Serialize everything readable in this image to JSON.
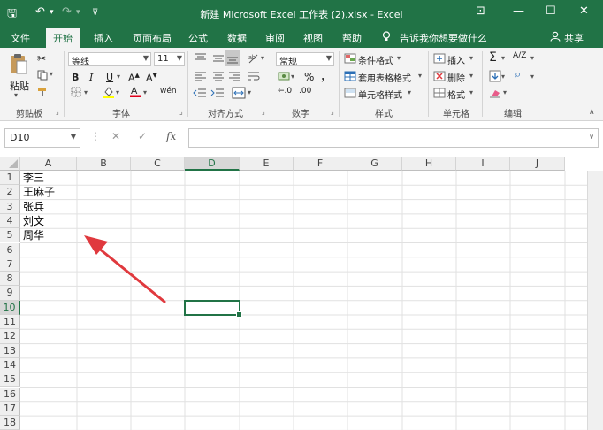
{
  "window": {
    "title": "新建 Microsoft Excel 工作表 (2).xlsx  -  Excel",
    "quick_access": {
      "save_glyph": "🖫",
      "undo_glyph": "↶",
      "undo_arrow": "▾",
      "redo_glyph": "↷",
      "redo_arrow": "▾",
      "customize_glyph": "⊽"
    },
    "controls": {
      "ribbon_opts_glyph": "⊡",
      "minimize_glyph": "—",
      "maximize_glyph": "☐",
      "close_glyph": "✕"
    }
  },
  "tabs": [
    {
      "label": "文件"
    },
    {
      "label": "开始"
    },
    {
      "label": "插入"
    },
    {
      "label": "页面布局"
    },
    {
      "label": "公式"
    },
    {
      "label": "数据"
    },
    {
      "label": "审阅"
    },
    {
      "label": "视图"
    },
    {
      "label": "帮助"
    }
  ],
  "tell_me": {
    "icon": "lightbulb-icon",
    "text": "告诉我你想要做什么"
  },
  "share": {
    "label": "共享",
    "icon": "person-icon"
  },
  "ribbon": {
    "clipboard": {
      "label": "剪贴板",
      "paste": "粘贴"
    },
    "font": {
      "label": "字体",
      "name": "等线",
      "size": "11",
      "bold": "B",
      "italic": "I",
      "underline": "U",
      "wen": "wén"
    },
    "alignment": {
      "label": "对齐方式"
    },
    "number": {
      "label": "数字",
      "format": "常规",
      "percent": "%",
      "comma": "，",
      "inc_dec": "←.0",
      "dec_dec": ".00"
    },
    "styles": {
      "label": "样式",
      "conditional": "条件格式",
      "table": "套用表格格式",
      "cell_styles": "单元格样式"
    },
    "cells": {
      "label": "单元格",
      "insert": "插入",
      "delete": "删除",
      "format": "格式"
    },
    "editing": {
      "label": "编辑",
      "sum": "Σ",
      "sort": "A/Z",
      "find": "⌕"
    }
  },
  "formula_bar": {
    "name_box": "D10",
    "cancel": "✕",
    "enter": "✓",
    "fx": "fx",
    "value": ""
  },
  "columns": [
    "A",
    "B",
    "C",
    "D",
    "E",
    "F",
    "G",
    "H",
    "I",
    "J"
  ],
  "selected_column": "D",
  "rows": [
    "1",
    "2",
    "3",
    "4",
    "5",
    "6",
    "7",
    "8",
    "9",
    "10",
    "11",
    "12",
    "13",
    "14",
    "15",
    "16",
    "17",
    "18"
  ],
  "selected_row": "10",
  "cells": {
    "A1": "李三",
    "A2": "王麻子",
    "A3": "张兵",
    "A4": "刘文",
    "A5": "周华"
  },
  "active_cell": "D10",
  "colors": {
    "brand": "#217346",
    "annotation_arrow": "#e0393e"
  }
}
